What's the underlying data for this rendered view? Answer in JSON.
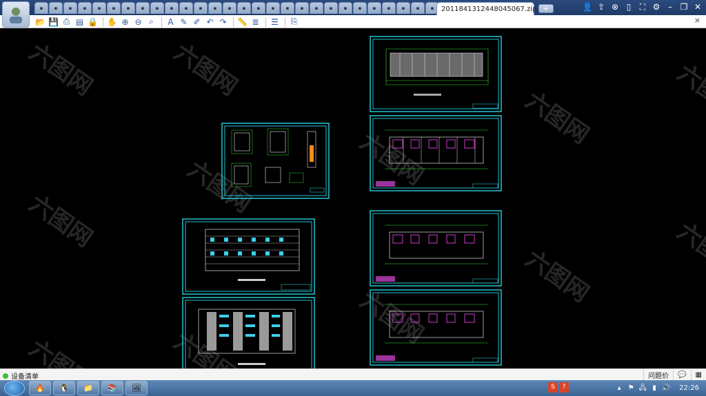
{
  "tabbar": {
    "active_tab_title": "20118413124480450​67.zip...",
    "active_tab_close": "×",
    "new_tab": "+",
    "inactive_tab_count": 29
  },
  "window_controls": [
    "users-icon",
    "share-icon",
    "link-icon",
    "phone-icon",
    "fullscreen-icon",
    "settings-icon",
    "minimize-icon",
    "restore-icon",
    "close-icon"
  ],
  "toolbar": {
    "groups": [
      [
        "open-icon",
        "save-icon",
        "print-icon",
        "pdf-icon",
        "lock-icon"
      ],
      [
        "pan-icon",
        "zoom-in-icon",
        "zoom-out-icon",
        "zoom-window-icon"
      ],
      [
        "text-icon",
        "pencil-icon",
        "highlighter-icon",
        "undo-icon",
        "redo-icon"
      ],
      [
        "ruler-icon",
        "measure-icon"
      ],
      [
        "layers-icon"
      ],
      [
        "export-icon"
      ]
    ],
    "close": "×"
  },
  "canvas": {
    "sheet_count": 7,
    "watermark_text": "六图网"
  },
  "statusbar": {
    "left_label": "设备清单",
    "help_label": "问题价",
    "chat_icon": "chat-icon",
    "grid_icon": "grid-icon"
  },
  "taskbar": {
    "start_label": "start",
    "tasks": [
      "browser-icon",
      "qq-icon",
      "folder-icon",
      "winrar-icon",
      "viewer-icon"
    ],
    "ime": [
      "S",
      "?"
    ],
    "clock": "22:26",
    "tray": [
      "up-arrow-icon",
      "flag-icon",
      "network-icon",
      "signal-icon",
      "volume-icon"
    ]
  }
}
